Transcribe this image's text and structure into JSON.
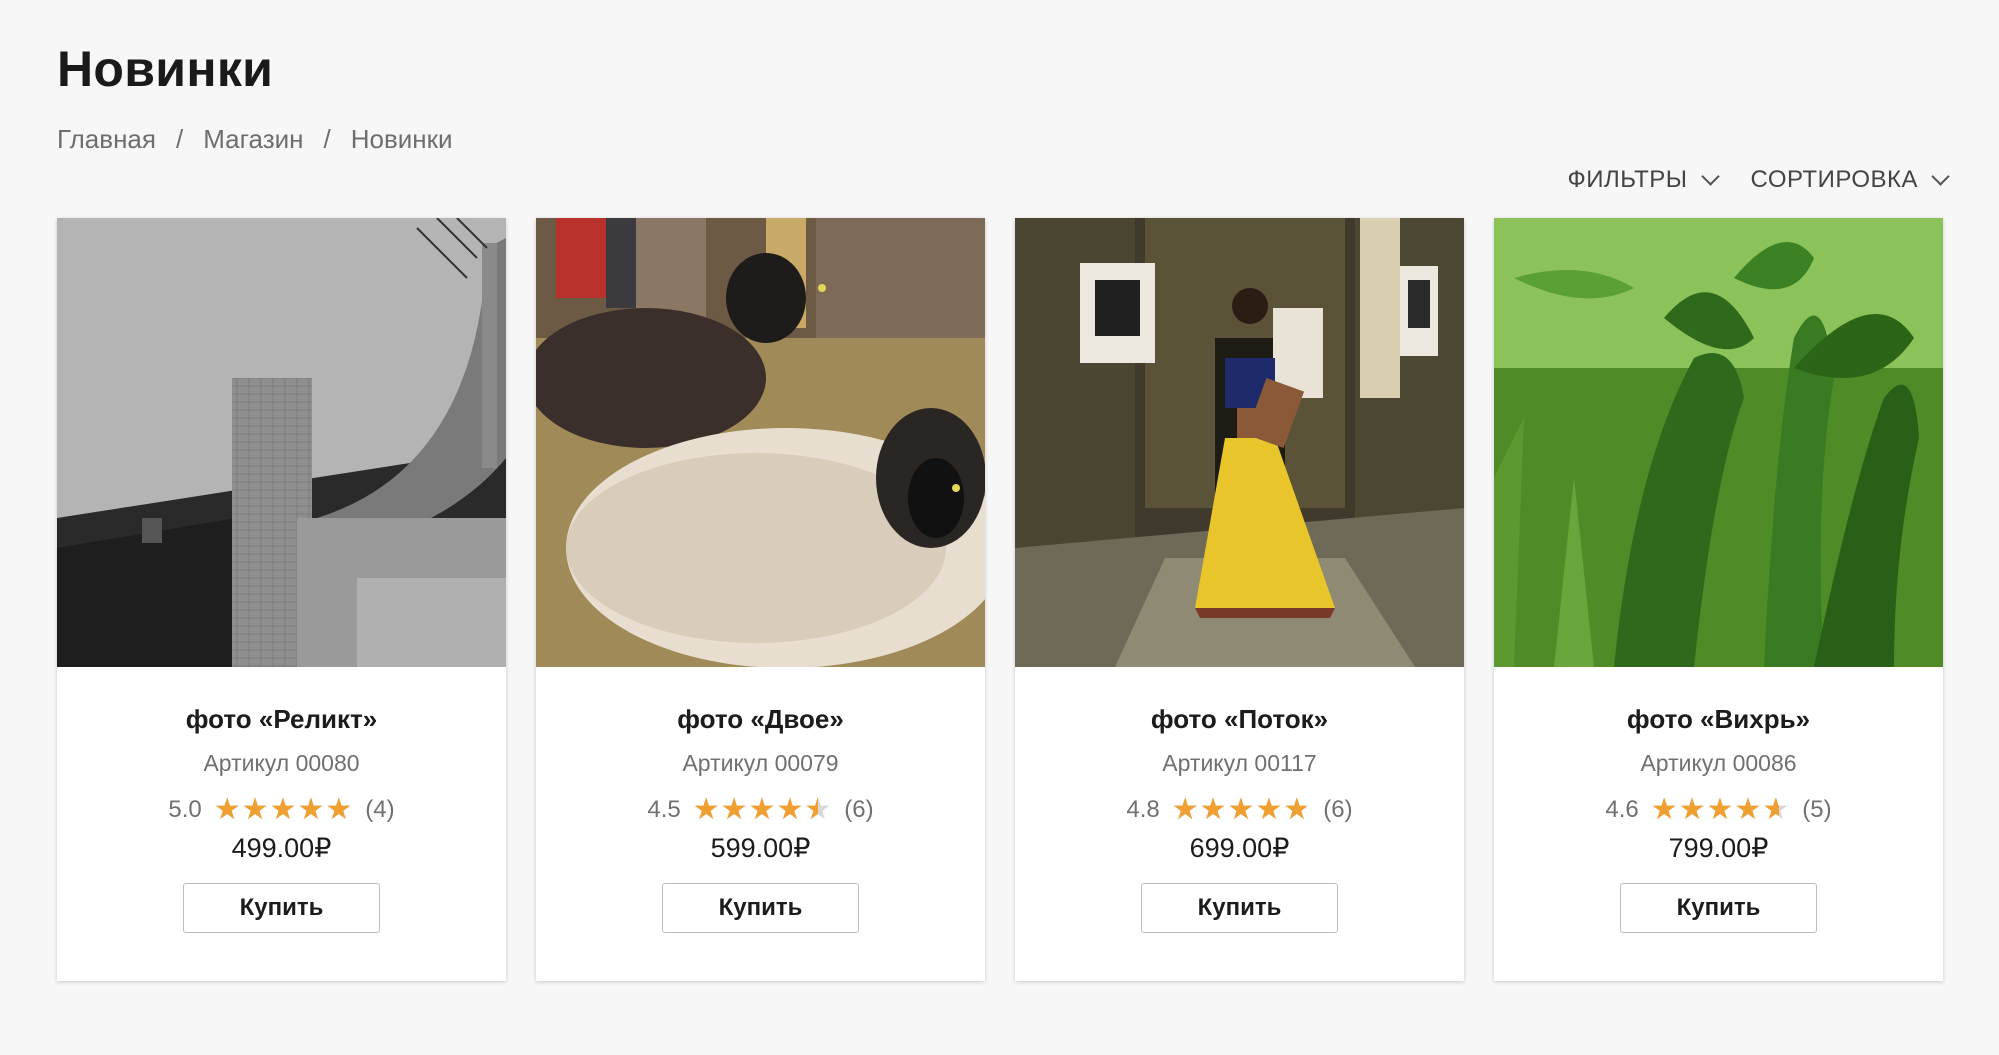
{
  "page": {
    "title": "Новинки"
  },
  "breadcrumb": {
    "items": [
      "Главная",
      "Магазин",
      "Новинки"
    ],
    "separator": "/"
  },
  "controls": {
    "filters_label": "ФИЛЬТРЫ",
    "sort_label": "СОРТИРОВКА"
  },
  "colors": {
    "background": "#f7f7f7",
    "card": "#ffffff",
    "star": "#f0a032",
    "text": "#1c1c1c",
    "muted": "#707070"
  },
  "products": [
    {
      "title": "фото «Реликт»",
      "sku": "Артикул 00080",
      "rating": "5.0",
      "rating_value": 5.0,
      "reviews": "(4)",
      "price": "499.00₽",
      "buy_label": "Купить",
      "image_subject": "black-and-white brick building with curved wall"
    },
    {
      "title": "фото «Двое»",
      "sku": "Артикул 00079",
      "rating": "4.5",
      "rating_value": 4.5,
      "reviews": "(6)",
      "price": "599.00₽",
      "buy_label": "Купить",
      "image_subject": "two sheep lying on straw"
    },
    {
      "title": "фото «Поток»",
      "sku": "Артикул 00117",
      "rating": "4.8",
      "rating_value": 4.8,
      "reviews": "(6)",
      "price": "699.00₽",
      "buy_label": "Купить",
      "image_subject": "dancer in yellow skirt in old hall"
    },
    {
      "title": "фото «Вихрь»",
      "sku": "Артикул 00086",
      "rating": "4.6",
      "rating_value": 4.6,
      "reviews": "(5)",
      "price": "799.00₽",
      "buy_label": "Купить",
      "image_subject": "green leafy plant in grass field"
    }
  ]
}
